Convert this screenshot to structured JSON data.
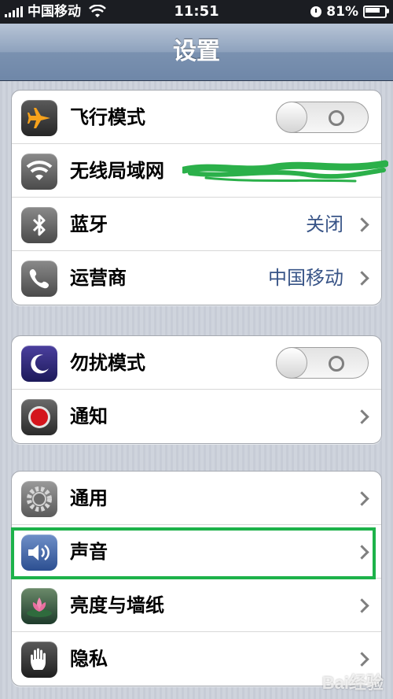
{
  "status_bar": {
    "carrier": "中国移动",
    "time": "11:51",
    "battery": "81%"
  },
  "nav": {
    "title": "设置"
  },
  "groups": [
    {
      "rows": [
        {
          "label": "飞行模式",
          "icon": "airplane-icon",
          "control": "toggle",
          "toggle_on": false
        },
        {
          "label": "无线局域网",
          "icon": "wifi-icon",
          "control": "chevron"
        },
        {
          "label": "蓝牙",
          "icon": "bluetooth-icon",
          "value": "关闭",
          "control": "chevron"
        },
        {
          "label": "运营商",
          "icon": "phone-icon",
          "value": "中国移动",
          "control": "chevron"
        }
      ]
    },
    {
      "rows": [
        {
          "label": "勿扰模式",
          "icon": "moon-icon",
          "control": "toggle",
          "toggle_on": false
        },
        {
          "label": "通知",
          "icon": "notification-icon",
          "control": "chevron"
        }
      ]
    },
    {
      "rows": [
        {
          "label": "通用",
          "icon": "gear-icon",
          "control": "chevron"
        },
        {
          "label": "声音",
          "icon": "speaker-icon",
          "control": "chevron"
        },
        {
          "label": "亮度与墙纸",
          "icon": "flower-icon",
          "control": "chevron"
        },
        {
          "label": "隐私",
          "icon": "hand-icon",
          "control": "chevron"
        }
      ]
    }
  ],
  "colors": {
    "value_text": "#385487",
    "highlight": "#1db24a",
    "scribble": "#2bb04a"
  },
  "watermark": "Bai经验"
}
